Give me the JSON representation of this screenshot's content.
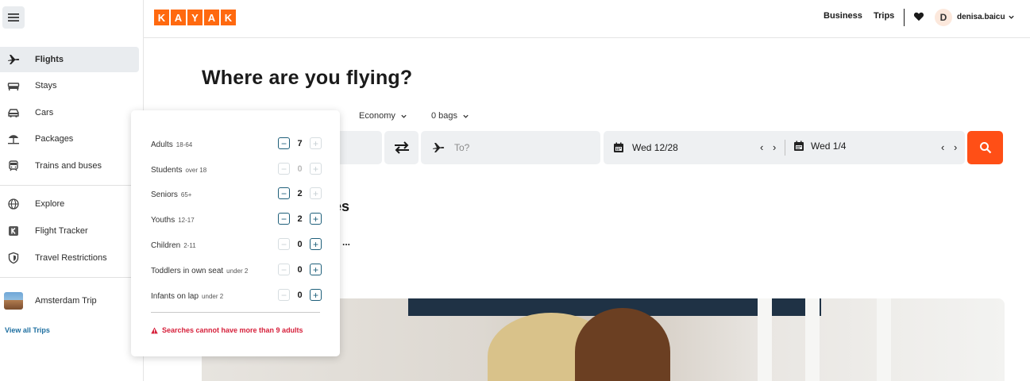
{
  "brand": {
    "letters": [
      "K",
      "A",
      "Y",
      "A",
      "K"
    ],
    "accent": "#ff690f"
  },
  "header": {
    "business": "Business",
    "trips": "Trips",
    "avatar_initial": "D",
    "username": "denisa.baicu"
  },
  "sidebar": {
    "items": [
      {
        "label": "Flights",
        "icon": "plane-icon"
      },
      {
        "label": "Stays",
        "icon": "bed-icon"
      },
      {
        "label": "Cars",
        "icon": "car-icon"
      },
      {
        "label": "Packages",
        "icon": "umbrella-icon"
      },
      {
        "label": "Trains and buses",
        "icon": "train-icon"
      },
      {
        "label": "Explore",
        "icon": "globe-icon"
      },
      {
        "label": "Flight Tracker",
        "icon": "kayak-k-icon"
      },
      {
        "label": "Travel Restrictions",
        "icon": "shield-icon"
      },
      {
        "label": "Amsterdam Trip",
        "icon": "trip-thumbnail"
      }
    ],
    "view_all": "View all Trips"
  },
  "main": {
    "title": "Where are you flying?",
    "cabin": "Economy",
    "bags": "0 bags",
    "to_placeholder": "To?",
    "depart_date": "Wed 12/28",
    "return_date": "Wed 1/4",
    "prev_next": "‹ ›",
    "partial_heading": "es",
    "partial_more": "..."
  },
  "travelers": {
    "rows": [
      {
        "label": "Adults",
        "sub": "18-64",
        "value": "7"
      },
      {
        "label": "Students",
        "sub": "over 18",
        "value": "0"
      },
      {
        "label": "Seniors",
        "sub": "65+",
        "value": "2"
      },
      {
        "label": "Youths",
        "sub": "12-17",
        "value": "2"
      },
      {
        "label": "Children",
        "sub": "2-11",
        "value": "0"
      },
      {
        "label": "Toddlers in own seat",
        "sub": "under 2",
        "value": "0"
      },
      {
        "label": "Infants on lap",
        "sub": "under 2",
        "value": "0"
      }
    ],
    "minus": "−",
    "plus": "+",
    "error": "Searches cannot have more than 9 adults"
  },
  "colors": {
    "search_button": "#ff4f16",
    "error": "#d61f3a",
    "stepper": "#1e5f7a"
  }
}
